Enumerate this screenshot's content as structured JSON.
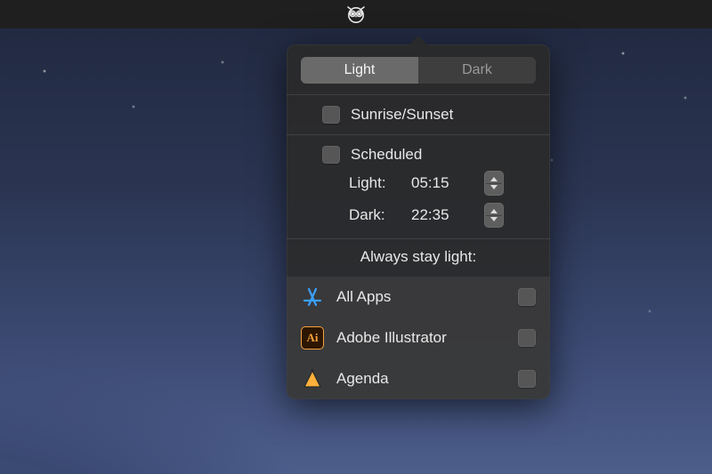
{
  "menubar": {
    "app_icon": "owl-icon"
  },
  "popover": {
    "segmented": {
      "light": "Light",
      "dark": "Dark",
      "active": "light"
    },
    "sunrise_sunset": {
      "label": "Sunrise/Sunset",
      "checked": false
    },
    "scheduled": {
      "label": "Scheduled",
      "checked": false,
      "light_label": "Light:",
      "light_time": "05:15",
      "dark_label": "Dark:",
      "dark_time": "22:35"
    },
    "always_label": "Always stay light:",
    "apps": [
      {
        "icon": "appstore",
        "name": "All Apps",
        "checked": false
      },
      {
        "icon": "illustrator",
        "name": "Adobe Illustrator",
        "checked": false
      },
      {
        "icon": "agenda",
        "name": "Agenda",
        "checked": false
      }
    ]
  },
  "colors": {
    "panel_bg": "#2a2a2a",
    "segment_active": "#6a6a6a",
    "segment_inactive": "#3e3e3e",
    "text": "#e8e8e8",
    "checkbox": "#565656"
  }
}
